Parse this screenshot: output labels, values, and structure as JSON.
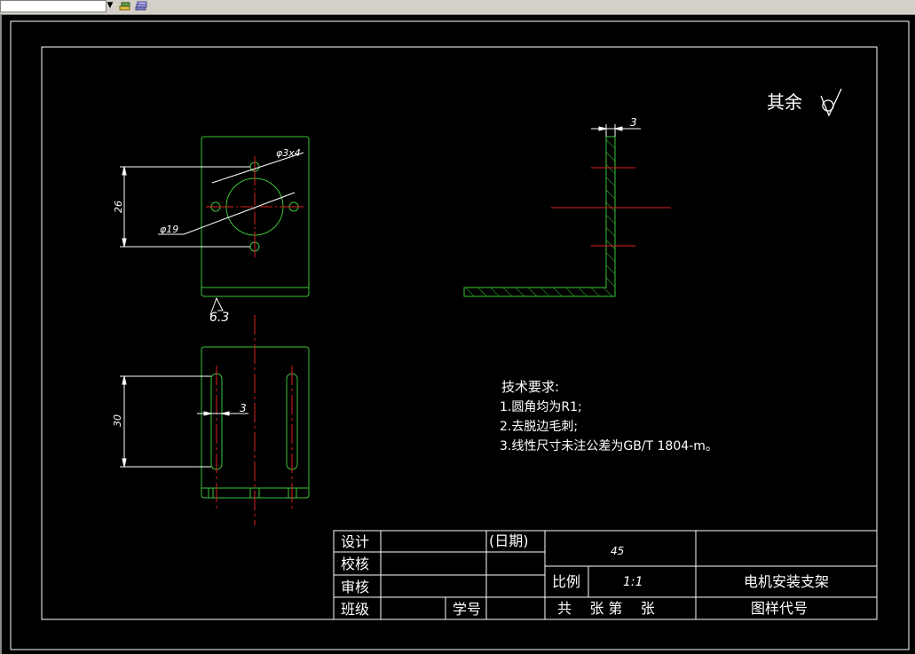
{
  "toolbar": {
    "layer_combo_value": "",
    "icons": [
      "layer-state-icon",
      "layer-properties-icon"
    ]
  },
  "drawing": {
    "surface_finish_note": "其余",
    "surface_finish_value": "6.3",
    "dims": {
      "hole_small": "φ3x4",
      "hole_large": "φ19",
      "height_top": "26",
      "height_bottom": "30",
      "slot_width": "3",
      "thickness": "3"
    },
    "tech_title": "技术要求:",
    "tech_items": [
      "1.圆角均为R1;",
      "2.去脱边毛刺;",
      "3.线性尺寸未注公差为GB/T 1804-m。"
    ]
  },
  "title_block": {
    "design": "设计",
    "date": "(日期)",
    "check": "校核",
    "review": "审核",
    "class": "班级",
    "student_no": "学号",
    "material": "45",
    "scale_label": "比例",
    "scale_value": "1:1",
    "part_name": "电机安装支架",
    "sheets": "共    张 第    张",
    "drawing_code": "图样代号"
  }
}
